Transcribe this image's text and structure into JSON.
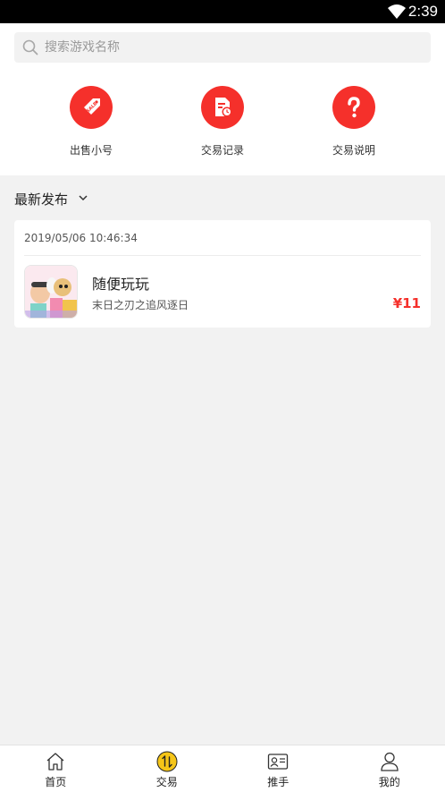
{
  "status_bar": {
    "time": "2:39"
  },
  "search": {
    "placeholder": "搜索游戏名称"
  },
  "quick_actions": [
    {
      "label": "出售小号",
      "icon": "sale-tag-icon"
    },
    {
      "label": "交易记录",
      "icon": "document-clock-icon"
    },
    {
      "label": "交易说明",
      "icon": "question-icon"
    }
  ],
  "latest": {
    "title": "最新发布",
    "items": [
      {
        "timestamp": "2019/05/06 10:46:34",
        "name": "随便玩玩",
        "game": "末日之刃之追风逐日",
        "price": "¥11"
      }
    ]
  },
  "tabbar": {
    "items": [
      {
        "label": "首页",
        "icon": "home-icon"
      },
      {
        "label": "交易",
        "icon": "trade-icon"
      },
      {
        "label": "推手",
        "icon": "id-card-icon"
      },
      {
        "label": "我的",
        "icon": "user-icon"
      }
    ]
  },
  "colors": {
    "accent": "#f5302b",
    "active_tab": "#f5c518",
    "background": "#f2f2f2"
  }
}
